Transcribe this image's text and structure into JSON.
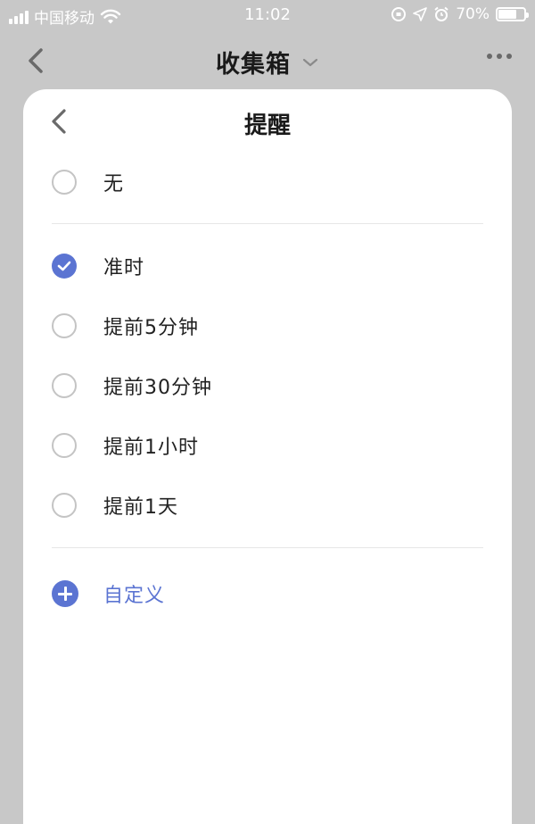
{
  "status_bar": {
    "carrier": "中国移动",
    "time": "11:02",
    "battery": "70%"
  },
  "nav": {
    "title": "收集箱"
  },
  "sheet": {
    "title": "提醒",
    "options": [
      {
        "label": "无",
        "checked": false
      },
      {
        "label": "准时",
        "checked": true
      },
      {
        "label": "提前5分钟",
        "checked": false
      },
      {
        "label": "提前30分钟",
        "checked": false
      },
      {
        "label": "提前1小时",
        "checked": false
      },
      {
        "label": "提前1天",
        "checked": false
      }
    ],
    "custom_label": "自定义"
  },
  "colors": {
    "accent": "#5b74d2",
    "background": "#c8c8c8",
    "sheet": "#ffffff"
  }
}
